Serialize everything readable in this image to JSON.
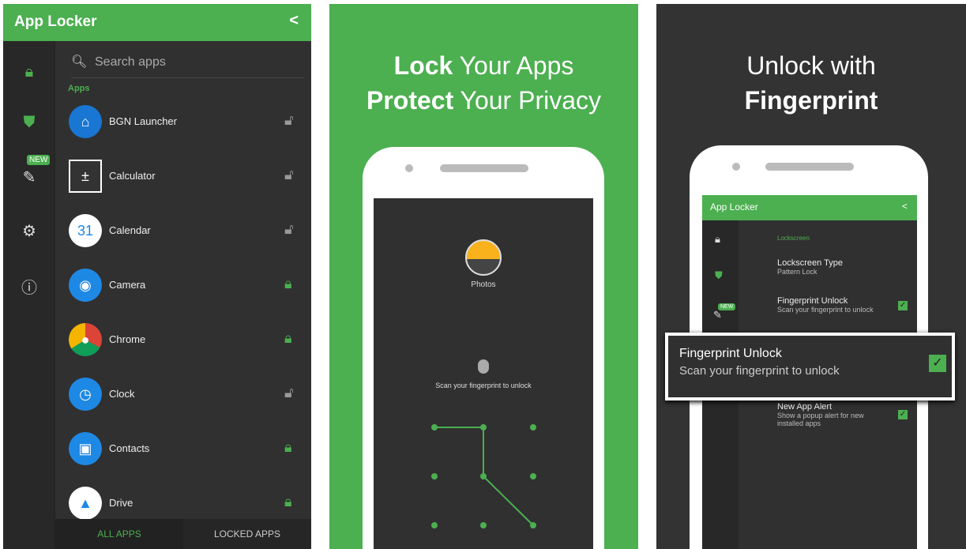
{
  "colors": {
    "accent": "#4caf50",
    "dark": "#303030"
  },
  "panel1": {
    "title": "App Locker",
    "share_icon": "share-icon",
    "sidebar": [
      {
        "icon": "lock-icon"
      },
      {
        "icon": "shield-icon"
      },
      {
        "icon": "magic-wand-icon",
        "badge": "NEW"
      },
      {
        "icon": "gear-icon"
      },
      {
        "icon": "info-icon"
      }
    ],
    "search_placeholder": "Search apps",
    "section": "Apps",
    "apps": [
      {
        "name": "BGN Launcher",
        "locked": false
      },
      {
        "name": "Calculator",
        "locked": false
      },
      {
        "name": "Calendar",
        "locked": false,
        "icon_text": "31"
      },
      {
        "name": "Camera",
        "locked": true
      },
      {
        "name": "Chrome",
        "locked": true
      },
      {
        "name": "Clock",
        "locked": false
      },
      {
        "name": "Contacts",
        "locked": true
      },
      {
        "name": "Drive",
        "locked": true
      }
    ],
    "tabs": [
      "ALL APPS",
      "LOCKED APPS"
    ]
  },
  "panel2": {
    "line1_bold": "Lock",
    "line1_rest": " Your Apps",
    "line2_bold": "Protect",
    "line2_rest": " Your Privacy",
    "app_label": "Photos",
    "scan_text": "Scan your fingerprint to unlock"
  },
  "panel3": {
    "line1": "Unlock with",
    "line2": "Fingerprint",
    "app_title": "App Locker",
    "badge": "NEW",
    "section": "Lockscreen",
    "settings": [
      {
        "title": "Lockscreen Type",
        "sub": "Pattern Lock"
      },
      {
        "title": "Fingerprint Unlock",
        "sub": "Scan your fingerprint to unlock",
        "checked": true
      },
      {
        "title": "New App Alert",
        "sub": "Show a popup alert for new installed apps",
        "checked": true
      }
    ],
    "popup": {
      "title": "Fingerprint Unlock",
      "sub": "Scan your fingerprint to unlock",
      "checked": true
    }
  }
}
